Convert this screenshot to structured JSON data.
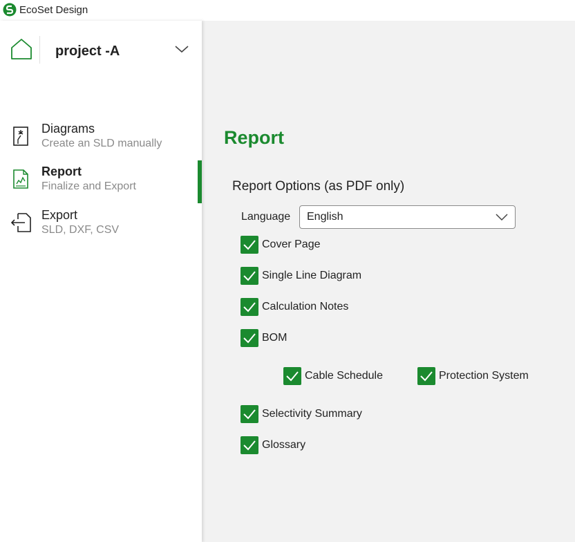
{
  "app": {
    "title": "EcoSet Design",
    "accent": "#1b8a2f"
  },
  "project": {
    "name": "project -A"
  },
  "nav": {
    "items": [
      {
        "title": "Diagrams",
        "subtitle": "Create an SLD manually",
        "icon": "diagram-icon",
        "active": false
      },
      {
        "title": "Report",
        "subtitle": "Finalize and Export",
        "icon": "report-icon",
        "active": true
      },
      {
        "title": "Export",
        "subtitle": "SLD, DXF, CSV",
        "icon": "export-icon",
        "active": false
      }
    ]
  },
  "report": {
    "title": "Report",
    "section_title": "Report Options (as PDF only)",
    "language": {
      "label": "Language",
      "value": "English"
    },
    "options": {
      "cover_page": {
        "label": "Cover Page",
        "checked": true
      },
      "single_line_diagram": {
        "label": "Single Line Diagram",
        "checked": true
      },
      "calculation_notes": {
        "label": "Calculation Notes",
        "checked": true
      },
      "bom": {
        "label": "BOM",
        "checked": true
      },
      "cable_schedule": {
        "label": "Cable Schedule",
        "checked": true
      },
      "protection_system": {
        "label": "Protection System",
        "checked": true
      },
      "selectivity_summary": {
        "label": "Selectivity Summary",
        "checked": true
      },
      "glossary": {
        "label": "Glossary",
        "checked": true
      }
    }
  }
}
